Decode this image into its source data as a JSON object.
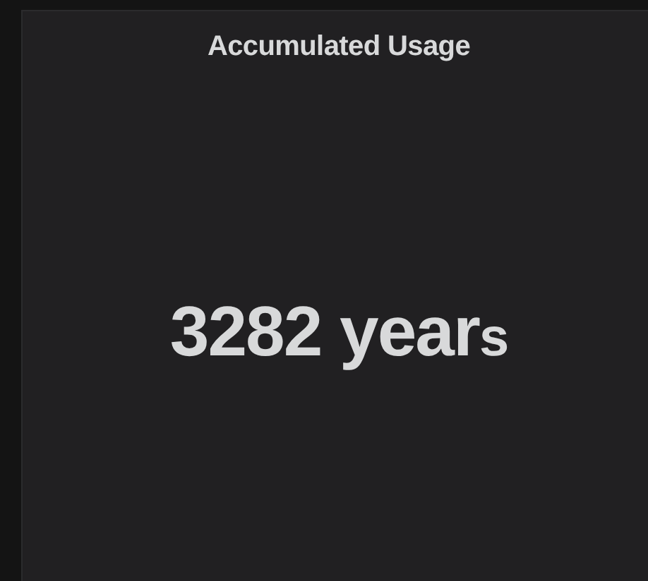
{
  "panel": {
    "title": "Accumulated Usage",
    "value": "3282 year",
    "postfix": "s"
  }
}
